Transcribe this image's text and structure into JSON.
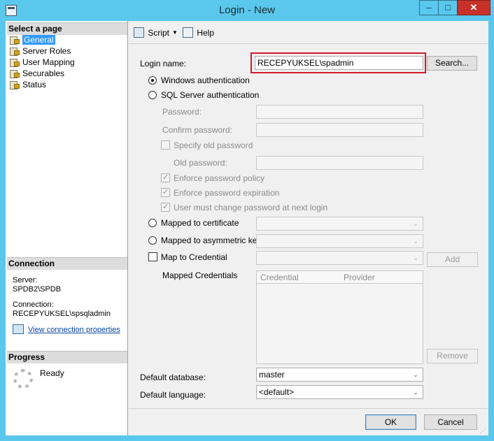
{
  "window": {
    "title": "Login - New",
    "minimize_glyph": "–",
    "maximize_glyph": "□",
    "close_glyph": "✕"
  },
  "left_panel": {
    "select_page_header": "Select a page",
    "pages": [
      {
        "label": "General",
        "selected": true,
        "icon": "page-icon"
      },
      {
        "label": "Server Roles",
        "selected": false,
        "icon": "page-icon"
      },
      {
        "label": "User Mapping",
        "selected": false,
        "icon": "page-icon"
      },
      {
        "label": "Securables",
        "selected": false,
        "icon": "page-icon"
      },
      {
        "label": "Status",
        "selected": false,
        "icon": "page-icon"
      }
    ],
    "connection_header": "Connection",
    "server_label": "Server:",
    "server_value": "SPDB2\\SPDB",
    "connection_label": "Connection:",
    "connection_value": "RECEPYUKSEL\\spsqladmin",
    "view_connection_link": "View connection properties",
    "progress_header": "Progress",
    "progress_status": "Ready"
  },
  "toolbar": {
    "script_label": "Script",
    "script_dropdown_glyph": "▼",
    "help_label": "Help"
  },
  "form": {
    "login_name_label": "Login name:",
    "login_name_value": "RECEPYUKSEL\\spadmin",
    "search_button": "Search...",
    "windows_auth": {
      "label": "Windows authentication",
      "checked": true
    },
    "sql_auth": {
      "label": "SQL Server authentication",
      "checked": false
    },
    "password_label": "Password:",
    "password_value": "",
    "confirm_password_label": "Confirm password:",
    "confirm_password_value": "",
    "specify_old_password": {
      "label": "Specify old password",
      "checked": false
    },
    "old_password_label": "Old password:",
    "old_password_value": "",
    "enforce_policy": {
      "label": "Enforce password policy",
      "checked": true
    },
    "enforce_expiration": {
      "label": "Enforce password expiration",
      "checked": true
    },
    "must_change": {
      "label": "User must change password at next login",
      "checked": true
    },
    "mapped_certificate": {
      "label": "Mapped to certificate",
      "checked": false,
      "value": ""
    },
    "mapped_asymmetric_key": {
      "label": "Mapped to asymmetric key",
      "checked": false,
      "value": ""
    },
    "map_to_credential": {
      "label": "Map to Credential",
      "checked": false,
      "value": ""
    },
    "add_button": "Add",
    "mapped_credentials_label": "Mapped Credentials",
    "credentials_columns": [
      "Credential",
      "Provider"
    ],
    "remove_button": "Remove",
    "default_database_label": "Default database:",
    "default_database_value": "master",
    "default_language_label": "Default language:",
    "default_language_value": "<default>",
    "combo_arrow_glyph": "⌄"
  },
  "buttons": {
    "ok": "OK",
    "cancel": "Cancel"
  },
  "colors": {
    "title_bar": "#5ac8ec",
    "selection": "#3399ff",
    "highlight_box": "#d11a2a",
    "close_button": "#c7312a"
  }
}
